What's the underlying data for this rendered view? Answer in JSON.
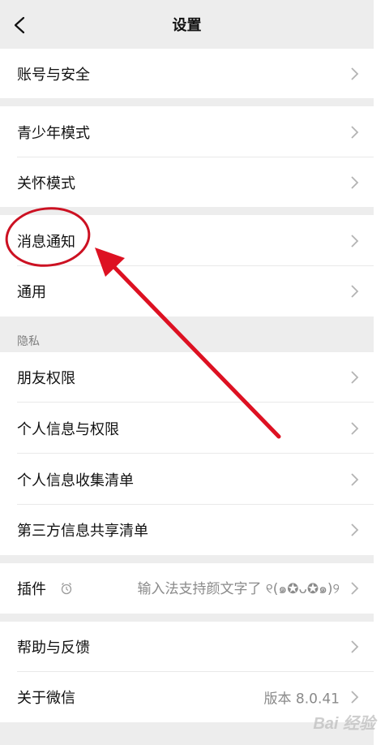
{
  "header": {
    "title": "设置"
  },
  "rows": {
    "account": "账号与安全",
    "youth": "青少年模式",
    "care": "关怀模式",
    "notify": "消息通知",
    "general": "通用",
    "friends": "朋友权限",
    "personal": "个人信息与权限",
    "collect": "个人信息收集清单",
    "share": "第三方信息共享清单",
    "plugin": "插件",
    "plugin_value": "输入法支持颜文字了 ୧(๑✪ᴗ✪๑)୨",
    "help": "帮助与反馈",
    "about": "关于微信",
    "about_value": "版本 8.0.41"
  },
  "sections": {
    "privacy": "隐私"
  },
  "watermark": "Bai 经验",
  "colors": {
    "background": "#ededed",
    "annotation_red": "#cc1122"
  },
  "icons": {
    "back": "chevron-left-icon",
    "row": "chevron-right-icon",
    "plugin": "alarm-clock-icon"
  }
}
